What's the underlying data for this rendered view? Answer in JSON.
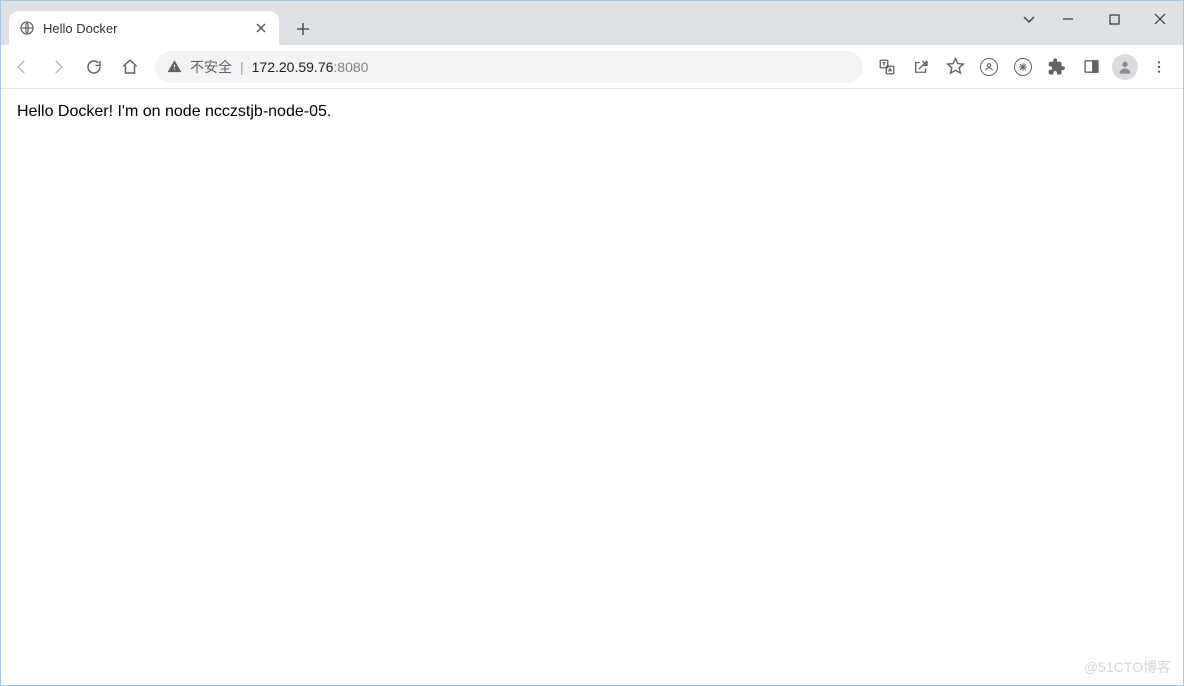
{
  "tab": {
    "title": "Hello Docker"
  },
  "address": {
    "insecure_label": "不安全",
    "host": "172.20.59.76",
    "port": ":8080"
  },
  "page": {
    "body_text": "Hello Docker! I'm on node ncczstjb-node-05."
  },
  "watermark": "@51CTO博客"
}
